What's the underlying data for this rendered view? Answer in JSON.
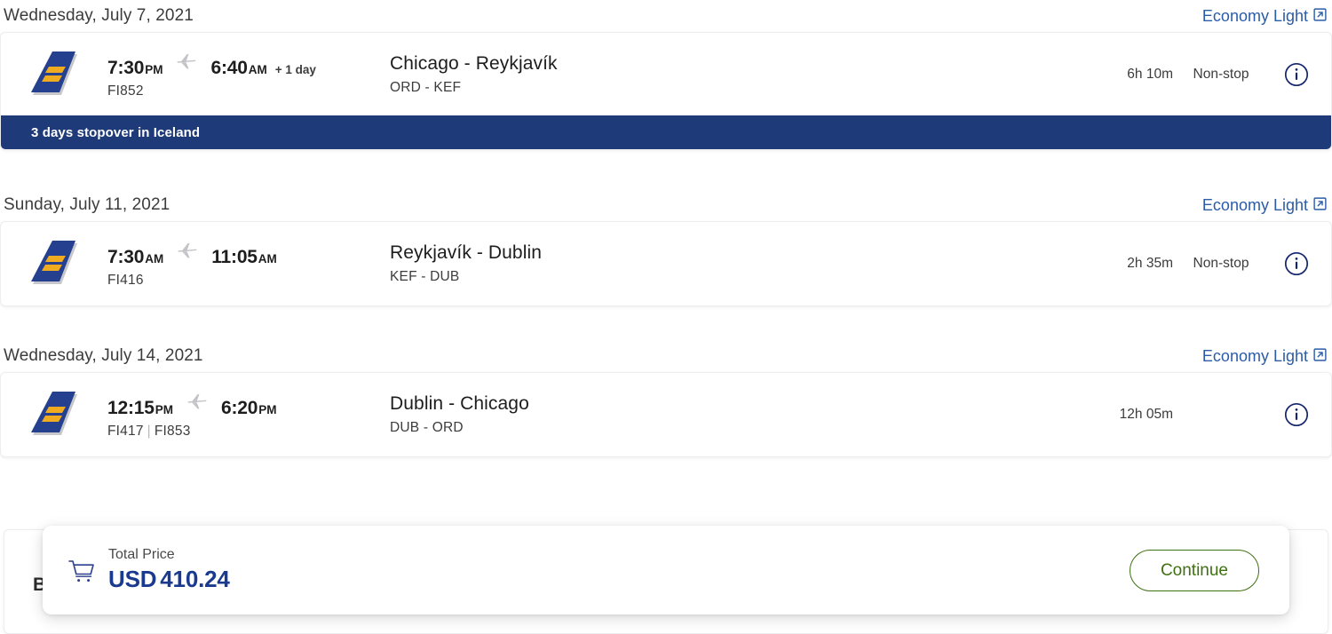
{
  "itinerary": {
    "segments": [
      {
        "date": "Wednesday, July 7, 2021",
        "fare": "Economy Light",
        "depart_time": "7:30",
        "depart_ampm": "PM",
        "arrive_time": "6:40",
        "arrive_ampm": "AM",
        "day_offset": "+ 1 day",
        "flight_numbers": "FI852",
        "route": "Chicago - Reykjavík",
        "airport_codes": "ORD - KEF",
        "duration": "6h 10m",
        "stops": "Non-stop",
        "stopover": "3 days stopover in Iceland"
      },
      {
        "date": "Sunday, July 11, 2021",
        "fare": "Economy Light",
        "depart_time": "7:30",
        "depart_ampm": "AM",
        "arrive_time": "11:05",
        "arrive_ampm": "AM",
        "day_offset": "",
        "flight_numbers": "FI416",
        "route": "Reykjavík - Dublin",
        "airport_codes": "KEF - DUB",
        "duration": "2h 35m",
        "stops": "Non-stop",
        "stopover": ""
      },
      {
        "date": "Wednesday, July 14, 2021",
        "fare": "Economy Light",
        "depart_time": "12:15",
        "depart_ampm": "PM",
        "arrive_time": "6:20",
        "arrive_ampm": "PM",
        "day_offset": "",
        "flight_number_first": "FI417",
        "flight_number_second": "FI853",
        "route": "Dublin - Chicago",
        "airport_codes": "DUB - ORD",
        "duration": "12h 05m",
        "stops": "",
        "stopover": ""
      }
    ]
  },
  "background_card": {
    "partial_text": "B"
  },
  "price_bar": {
    "label": "Total Price",
    "currency": "USD",
    "amount": "410.24",
    "continue_label": "Continue"
  },
  "colors": {
    "brand_navy": "#1e3a78",
    "link_blue": "#2b5ca8",
    "price_navy": "#1a3a8f",
    "continue_green": "#3f7012",
    "logo_gold": "#f0ab20"
  },
  "icons": {
    "external_link": "external-link-icon",
    "info": "info-icon",
    "plane": "plane-icon",
    "cart": "shopping-cart-icon",
    "airline_logo": "icelandair-tail-logo"
  }
}
